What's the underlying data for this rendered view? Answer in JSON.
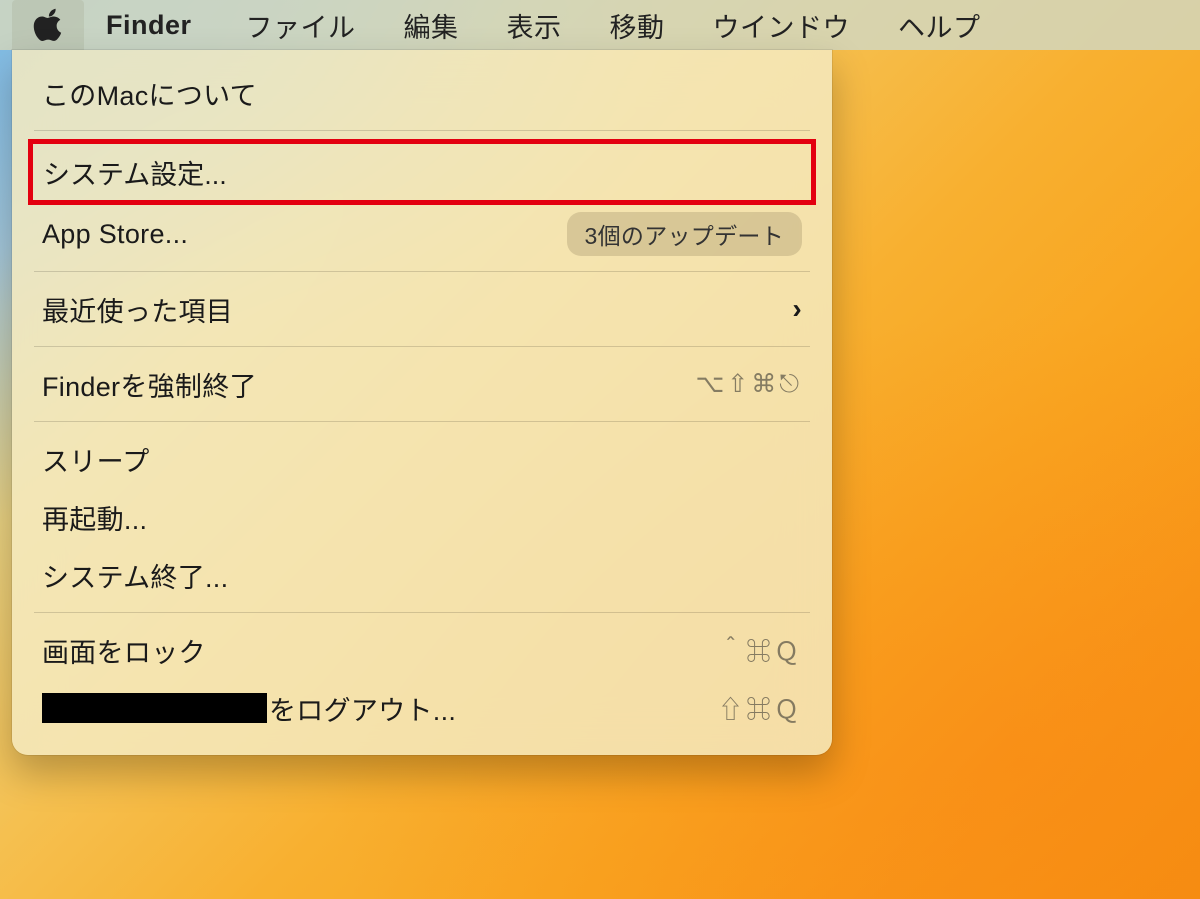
{
  "menubar": {
    "app": "Finder",
    "items": [
      "ファイル",
      "編集",
      "表示",
      "移動",
      "ウインドウ",
      "ヘルプ"
    ]
  },
  "dropdown": {
    "about": "このMacについて",
    "system_settings": "システム設定...",
    "app_store": "App Store...",
    "app_store_badge": "3個のアップデート",
    "recent_items": "最近使った項目",
    "force_quit": "Finderを強制終了",
    "force_quit_shortcut": "⌥⇧⌘⎋",
    "sleep": "スリープ",
    "restart": "再起動...",
    "shutdown": "システム終了...",
    "lock_screen": "画面をロック",
    "lock_screen_shortcut": "＾⌘Ｑ",
    "logout_suffix": "をログアウト...",
    "logout_shortcut": "⇧⌘Ｑ"
  }
}
